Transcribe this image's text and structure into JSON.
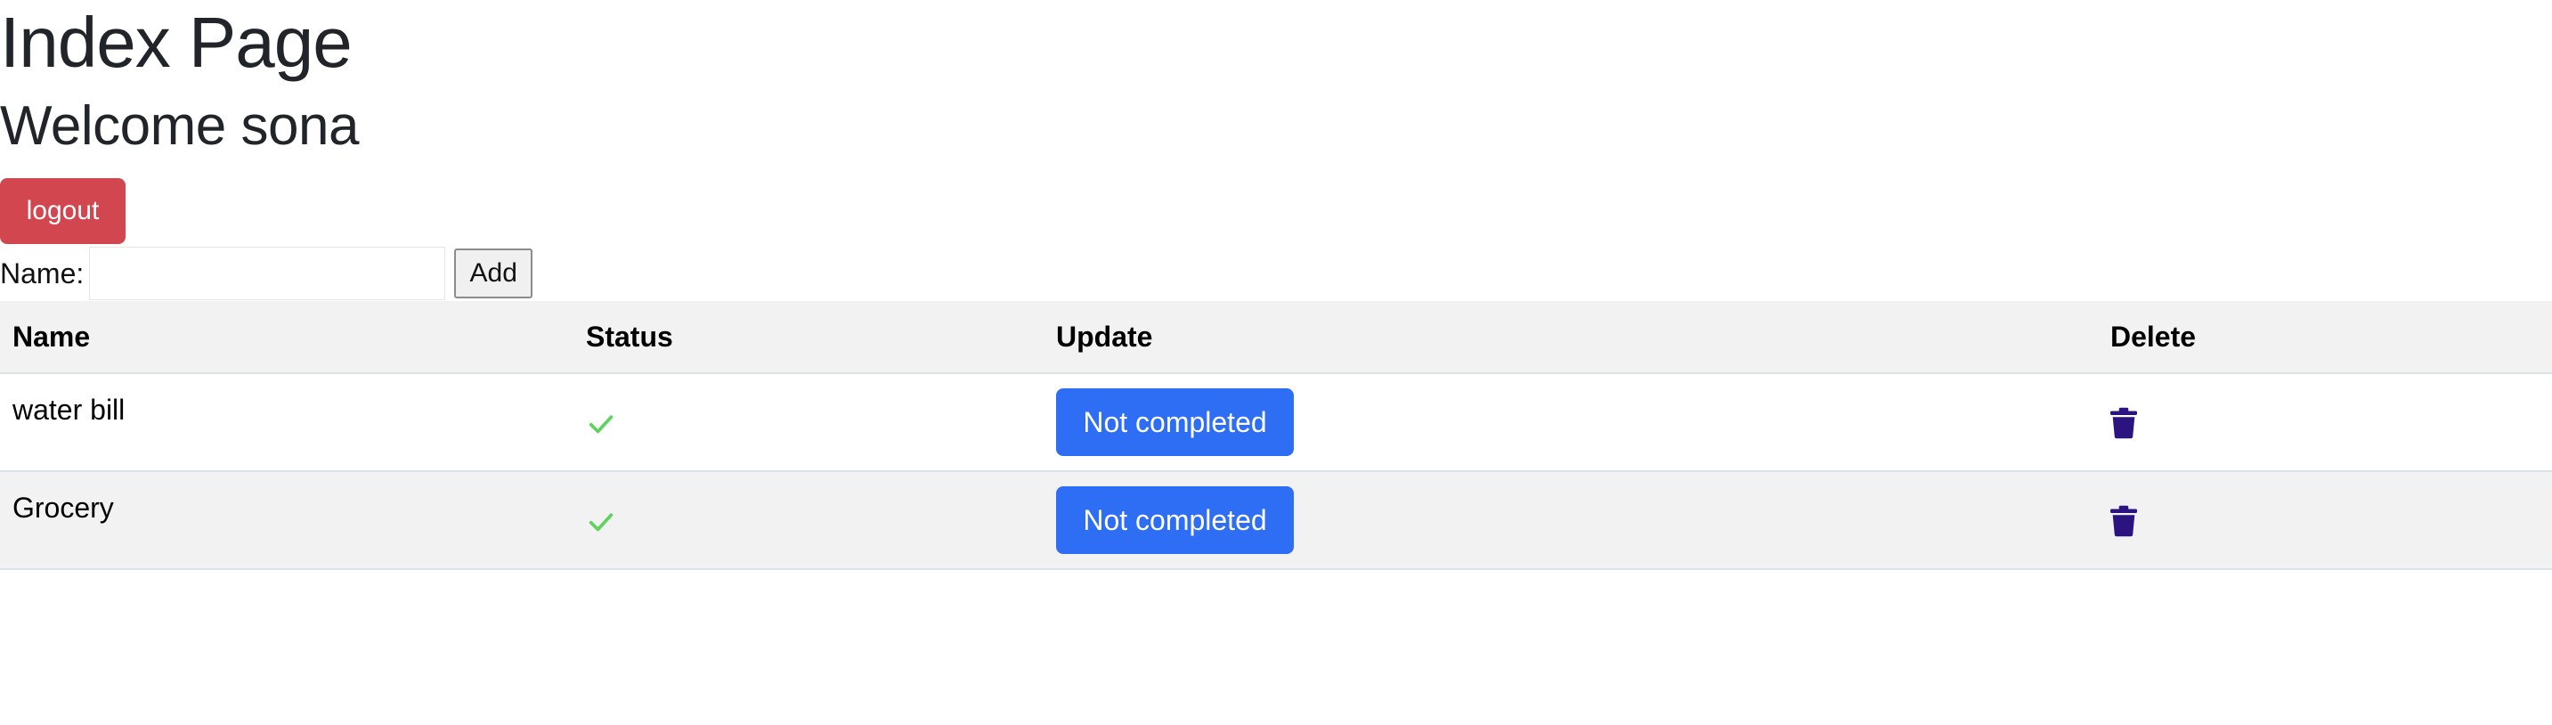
{
  "page": {
    "title": "Index Page",
    "welcome": "Welcome sona"
  },
  "actions": {
    "logout_label": "logout"
  },
  "add_form": {
    "name_label": "Name:",
    "name_value": "",
    "name_placeholder": "",
    "add_label": "Add"
  },
  "table": {
    "headers": {
      "name": "Name",
      "status": "Status",
      "update": "Update",
      "delete": "Delete"
    },
    "rows": [
      {
        "name": "water bill",
        "status_icon": "check-icon",
        "update_label": "Not completed",
        "delete_icon": "trash-icon"
      },
      {
        "name": "Grocery",
        "status_icon": "check-icon",
        "update_label": "Not completed",
        "delete_icon": "trash-icon"
      }
    ]
  },
  "colors": {
    "logout_bg": "#d2474f",
    "update_bg": "#2d6ef5",
    "check_color": "#5fd35f",
    "trash_color": "#2b1380",
    "striped_row_bg": "#f2f2f2"
  }
}
